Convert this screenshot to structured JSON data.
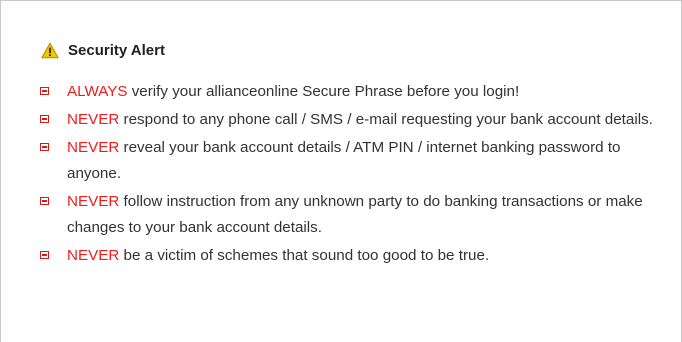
{
  "alert": {
    "icon": "warning-triangle-icon",
    "title": "Security Alert",
    "colors": {
      "keyword": "#ee1c1c",
      "bullet": "#d41b1b",
      "icon_fill": "#f5c400",
      "text": "#333333"
    },
    "items": [
      {
        "keyword": "ALWAYS",
        "text": " verify your allianceonline Secure Phrase before you login!"
      },
      {
        "keyword": "NEVER",
        "text": " respond to any phone call / SMS / e-mail requesting your bank account details."
      },
      {
        "keyword": "NEVER",
        "text": " reveal your bank account details / ATM PIN / internet banking password to anyone."
      },
      {
        "keyword": "NEVER",
        "text": " follow instruction from any unknown party to do banking transactions or make changes to your bank account details."
      },
      {
        "keyword": "NEVER",
        "text": " be a victim of schemes that sound too good to be true."
      }
    ]
  }
}
